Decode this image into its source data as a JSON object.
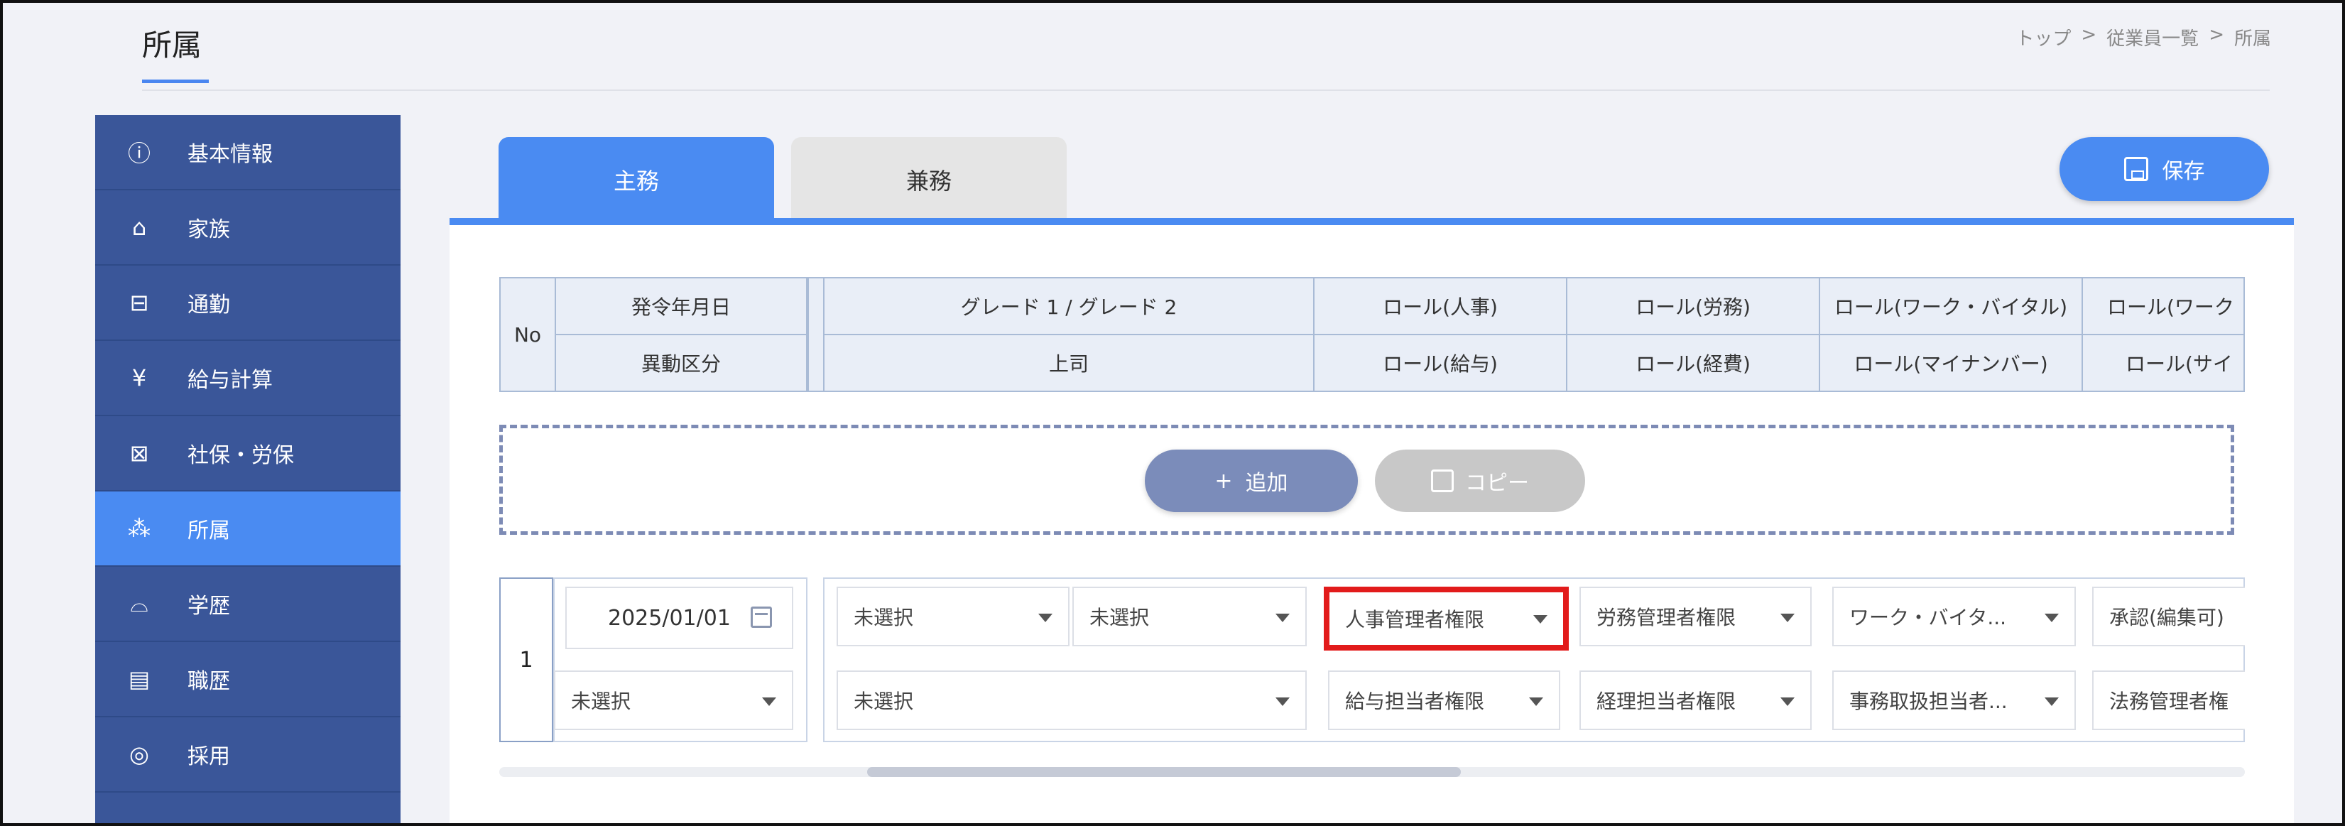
{
  "page": {
    "title": "所属"
  },
  "breadcrumb": [
    "トップ",
    ">",
    "従業員一覧",
    ">",
    "所属"
  ],
  "sidebar": {
    "items": [
      {
        "label": "基本情報",
        "icon": "info-icon",
        "glyph": "ⓘ",
        "active": false
      },
      {
        "label": "家族",
        "icon": "house-icon",
        "glyph": "⌂",
        "active": false
      },
      {
        "label": "通勤",
        "icon": "train-icon",
        "glyph": "⊟",
        "active": false
      },
      {
        "label": "給与計算",
        "icon": "yen-icon",
        "glyph": "¥",
        "active": false
      },
      {
        "label": "社保・労保",
        "icon": "insurance-icon",
        "glyph": "⊠",
        "active": false
      },
      {
        "label": "所属",
        "icon": "org-chart-icon",
        "glyph": "⁂",
        "active": true
      },
      {
        "label": "学歴",
        "icon": "graduation-cap-icon",
        "glyph": "⌓",
        "active": false
      },
      {
        "label": "職歴",
        "icon": "document-icon",
        "glyph": "▤",
        "active": false
      },
      {
        "label": "採用",
        "icon": "magnifier-icon",
        "glyph": "◎",
        "active": false
      }
    ]
  },
  "tabs": [
    {
      "label": "主務"
    },
    {
      "label": "兼務"
    }
  ],
  "toolbar": {
    "save_label": "保存",
    "add_label": "追加",
    "copy_label": "コピー",
    "add_glyph": "+"
  },
  "table": {
    "header_row1": {
      "no": "No",
      "col1": "発令年月日",
      "col2": "グレード 1 / グレード 2",
      "col3": "ロール(人事)",
      "col4": "ロール(労務)",
      "col5": "ロール(ワーク・バイタル)",
      "col6": "ロール(ワーク"
    },
    "header_row2": {
      "col1": "異動区分",
      "col2": "上司",
      "col3": "ロール(給与)",
      "col4": "ロール(経費)",
      "col5": "ロール(マイナンバー)",
      "col6": "ロール(サイ"
    },
    "rows": [
      {
        "no": "1",
        "date": "2025/01/01",
        "transfer_type": "未選択",
        "grade1": "未選択",
        "grade2": "未選択",
        "boss": "未選択",
        "role_hr": "人事管理者権限",
        "role_labor": "労務管理者権限",
        "role_work_vital": "ワーク・バイタ...",
        "role_work2": "承認(編集可)",
        "role_payroll": "給与担当者権限",
        "role_expense": "経理担当者権限",
        "role_mynumber": "事務取扱担当者...",
        "role_sign": "法務管理者権"
      }
    ]
  },
  "colors": {
    "accent": "#4a8bf2",
    "sidebar": "#3a5699",
    "highlight": "#e21b1b"
  }
}
